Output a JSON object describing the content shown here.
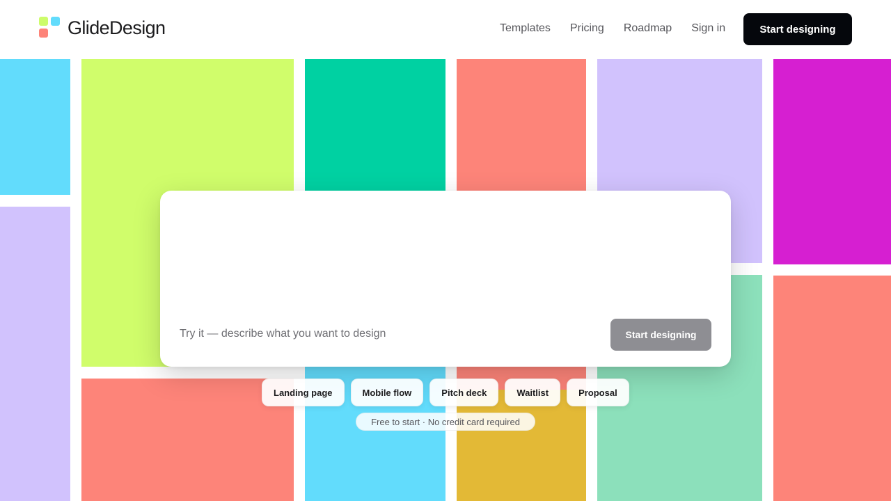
{
  "app": {
    "brand_name": "GlideDesign",
    "logo_colors": [
      "#cdfc6b",
      "#62dcfc",
      "#fd8479"
    ]
  },
  "nav": {
    "items": [
      {
        "label": "Templates"
      },
      {
        "label": "Pricing"
      },
      {
        "label": "Roadmap"
      },
      {
        "label": "Sign in"
      }
    ],
    "cta_label": "Start designing"
  },
  "hero": {
    "prompt_placeholder": "Try it — describe what you want to design",
    "prompt_value": "",
    "submit_label": "Start designing",
    "suggestions": [
      {
        "label": "Landing page"
      },
      {
        "label": "Mobile flow"
      },
      {
        "label": "Pitch deck"
      },
      {
        "label": "Waitlist"
      },
      {
        "label": "Proposal"
      }
    ],
    "note": "Free to start · No credit card required"
  },
  "mosaic": {
    "tile_colors": [
      "#62dcfc",
      "#d1c2fd",
      "#d0fd6b",
      "#fd8479",
      "#00d1a2",
      "#62dcfc",
      "#fd8479",
      "#fd8479",
      "#e3b936",
      "#d1c2fd",
      "#8ce0bb",
      "#d61fd1",
      "#fd8479"
    ]
  }
}
